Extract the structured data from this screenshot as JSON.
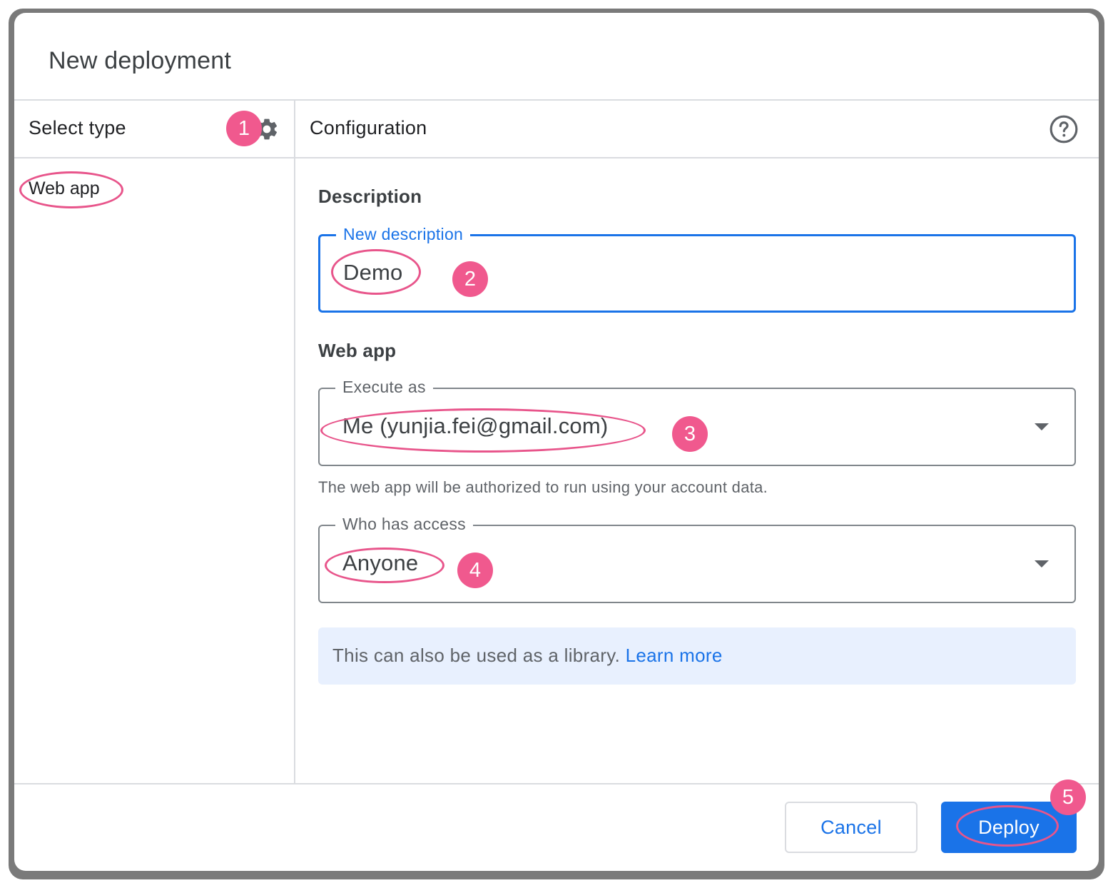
{
  "dialog": {
    "title": "New deployment"
  },
  "left_panel": {
    "header": "Select type",
    "settings_icon": "gear-icon",
    "items": [
      {
        "label": "Web app"
      }
    ]
  },
  "right_panel": {
    "header": "Configuration",
    "help_icon": "help-circle-icon",
    "description": {
      "section_label": "Description",
      "field_label": "New description",
      "value": "Demo"
    },
    "web_app": {
      "section_label": "Web app",
      "execute_as": {
        "label": "Execute as",
        "value": "Me (yunjia.fei@gmail.com)",
        "helper": "The web app will be authorized to run using your account data."
      },
      "who_has_access": {
        "label": "Who has access",
        "value": "Anyone"
      }
    },
    "info": {
      "text": "This can also be used as a library.",
      "link": "Learn more"
    }
  },
  "footer": {
    "cancel_label": "Cancel",
    "deploy_label": "Deploy"
  },
  "annotations": {
    "step_badges": [
      "1",
      "2",
      "3",
      "4",
      "5"
    ],
    "badge_color": "#f0598e"
  },
  "colors": {
    "accent": "#1a73e8",
    "info_background": "#e8f0fe",
    "divider": "#dadce0"
  }
}
